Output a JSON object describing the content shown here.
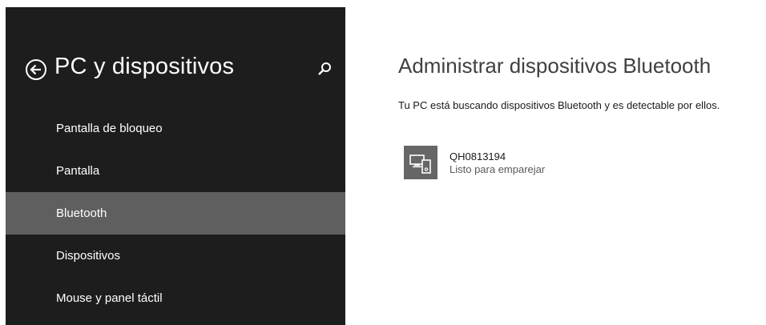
{
  "sidebar": {
    "back_icon": "back-arrow-circle-icon",
    "title": "PC y dispositivos",
    "search_icon": "search-icon",
    "items": [
      {
        "label": "Pantalla de bloqueo",
        "selected": false
      },
      {
        "label": "Pantalla",
        "selected": false
      },
      {
        "label": "Bluetooth",
        "selected": true
      },
      {
        "label": "Dispositivos",
        "selected": false
      },
      {
        "label": "Mouse y panel táctil",
        "selected": false
      }
    ]
  },
  "main": {
    "title": "Administrar dispositivos Bluetooth",
    "status": "Tu PC está buscando dispositivos Bluetooth y es detectable por ellos.",
    "devices": [
      {
        "icon": "computer-and-phone-icon",
        "name": "QH0813194",
        "status": "Listo para emparejar"
      }
    ]
  },
  "colors": {
    "sidebar_bg": "#1d1d1d",
    "selected_bg": "#5f5f5f",
    "device_tile_bg": "#666666",
    "title_text": "#404040"
  }
}
